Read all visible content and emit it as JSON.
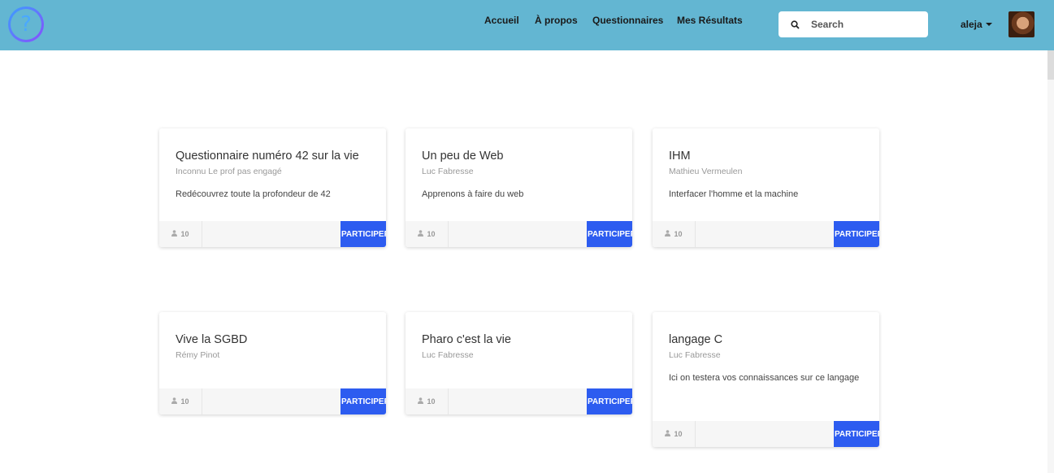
{
  "nav": {
    "links": [
      "Accueil",
      "À propos",
      "Questionnaires",
      "Mes Résultats"
    ],
    "search_placeholder": "Search",
    "user_name": "aleja"
  },
  "cards": [
    {
      "title": "Questionnaire numéro 42 sur la vie",
      "author": "Inconnu Le prof pas engagé",
      "description": "Redécouvrez toute la profondeur de 42",
      "count": "10",
      "button": "PARTICIPER"
    },
    {
      "title": "Un peu de Web",
      "author": "Luc Fabresse",
      "description": "Apprenons à faire du web",
      "count": "10",
      "button": "PARTICIPER"
    },
    {
      "title": "IHM",
      "author": "Mathieu Vermeulen",
      "description": "Interfacer l'homme et la machine",
      "count": "10",
      "button": "PARTICIPER"
    },
    {
      "title": "Vive la SGBD",
      "author": "Rémy Pinot",
      "description": "",
      "count": "10",
      "button": "PARTICIPER"
    },
    {
      "title": "Pharo c'est la vie",
      "author": "Luc Fabresse",
      "description": "",
      "count": "10",
      "button": "PARTICIPER"
    },
    {
      "title": "langage C",
      "author": "Luc Fabresse",
      "description": "Ici on testera vos connaissances sur ce langage",
      "count": "10",
      "button": "PARTICIPER"
    }
  ],
  "colors": {
    "navbar": "#63b6d2",
    "button": "#2d5cf0"
  },
  "icons": {
    "logo": "question-mark-logo",
    "search": "search-icon",
    "user_count": "user-icon"
  }
}
